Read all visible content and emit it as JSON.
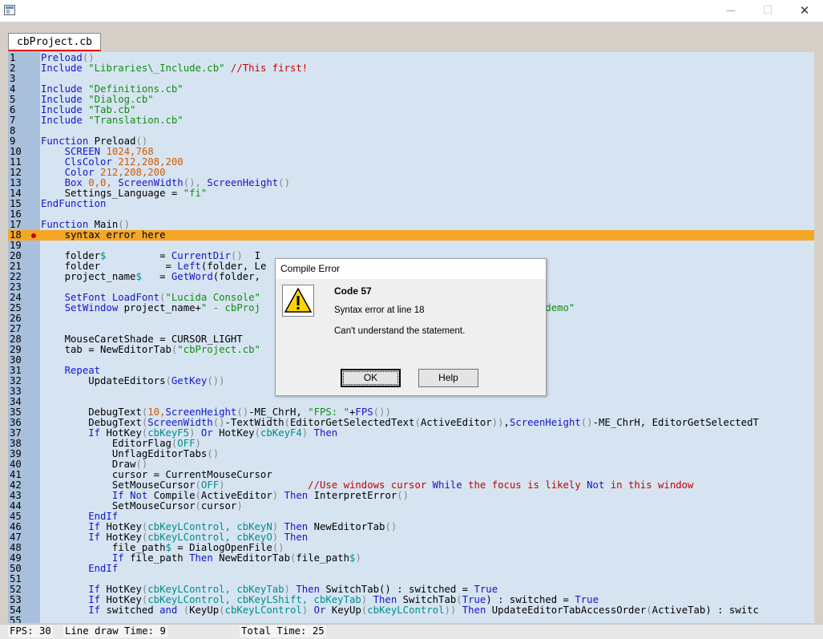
{
  "window": {
    "min_icon": "—",
    "max_icon": "☐",
    "close_icon": "✕"
  },
  "tab": {
    "label": "cbProject.cb"
  },
  "editor": {
    "lines": [
      {
        "n": "1",
        "t": [
          [
            "Preload",
            "kw"
          ],
          [
            "()",
            "dim"
          ]
        ]
      },
      {
        "n": "2",
        "t": [
          [
            "Include ",
            "kw"
          ],
          [
            "\"Libraries\\_Include.cb\" ",
            "str"
          ],
          [
            "//This first!",
            "com"
          ]
        ]
      },
      {
        "n": "3",
        "t": []
      },
      {
        "n": "4",
        "t": [
          [
            "Include ",
            "kw"
          ],
          [
            "\"Definitions.cb\"",
            "str"
          ]
        ]
      },
      {
        "n": "5",
        "t": [
          [
            "Include ",
            "kw"
          ],
          [
            "\"Dialog.cb\"",
            "str"
          ]
        ]
      },
      {
        "n": "6",
        "t": [
          [
            "Include ",
            "kw"
          ],
          [
            "\"Tab.cb\"",
            "str"
          ]
        ]
      },
      {
        "n": "7",
        "t": [
          [
            "Include ",
            "kw"
          ],
          [
            "\"Translation.cb\"",
            "str"
          ]
        ]
      },
      {
        "n": "8",
        "t": []
      },
      {
        "n": "9",
        "t": [
          [
            "Function ",
            "kw"
          ],
          [
            "Preload",
            "op"
          ],
          [
            "()",
            "dim"
          ]
        ]
      },
      {
        "n": "10",
        "t": [
          [
            "    SCREEN ",
            "kw"
          ],
          [
            "1024,768",
            "num"
          ]
        ]
      },
      {
        "n": "11",
        "t": [
          [
            "    ClsColor ",
            "kw"
          ],
          [
            "212,208,200",
            "num"
          ]
        ]
      },
      {
        "n": "12",
        "t": [
          [
            "    Color ",
            "kw"
          ],
          [
            "212,208,200",
            "num"
          ]
        ]
      },
      {
        "n": "13",
        "t": [
          [
            "    Box ",
            "kw"
          ],
          [
            "0,0, ",
            "num"
          ],
          [
            "ScreenWidth",
            "kw"
          ],
          [
            "(), ",
            "dim"
          ],
          [
            "ScreenHeight",
            "kw"
          ],
          [
            "()",
            "dim"
          ]
        ]
      },
      {
        "n": "14",
        "t": [
          [
            "    Settings_Language = ",
            "op"
          ],
          [
            "\"fi\"",
            "str"
          ]
        ]
      },
      {
        "n": "15",
        "t": [
          [
            "EndFunction",
            "kw"
          ]
        ]
      },
      {
        "n": "16",
        "t": []
      },
      {
        "n": "17",
        "t": [
          [
            "Function ",
            "kw"
          ],
          [
            "Main",
            "op"
          ],
          [
            "()",
            "dim"
          ]
        ]
      },
      {
        "n": "18",
        "t": [
          [
            "    syntax error here",
            "op"
          ]
        ],
        "err": true
      },
      {
        "n": "19",
        "t": []
      },
      {
        "n": "20",
        "t": [
          [
            "    folder",
            "op"
          ],
          [
            "$",
            "var"
          ],
          [
            "         = ",
            "op"
          ],
          [
            "CurrentDir",
            "kw"
          ],
          [
            "()  ",
            "dim"
          ],
          [
            "I",
            "op"
          ]
        ]
      },
      {
        "n": "21",
        "t": [
          [
            "    folder           = ",
            "op"
          ],
          [
            "Left",
            "kw"
          ],
          [
            "(folder, Le",
            "op"
          ]
        ]
      },
      {
        "n": "22",
        "t": [
          [
            "    project_name",
            "op"
          ],
          [
            "$",
            "var"
          ],
          [
            "   = ",
            "op"
          ],
          [
            "GetWord",
            "kw"
          ],
          [
            "(folder,",
            "op"
          ]
        ]
      },
      {
        "n": "23",
        "t": []
      },
      {
        "n": "24",
        "t": [
          [
            "    SetFont ",
            "kw"
          ],
          [
            "LoadFont",
            "kw"
          ],
          [
            "(",
            "dim"
          ],
          [
            "\"Lucida Console\"",
            "str"
          ]
        ]
      },
      {
        "n": "25",
        "t": [
          [
            "    SetWindow ",
            "kw"
          ],
          [
            "project_name+",
            "op"
          ],
          [
            "\" - cbProj",
            "str"
          ],
          [
            "                                 of the alpha's demo\"",
            "str"
          ]
        ]
      },
      {
        "n": "26",
        "t": []
      },
      {
        "n": "27",
        "t": []
      },
      {
        "n": "28",
        "t": [
          [
            "    MouseCaretShade = CURSOR_LIGHT",
            "op"
          ]
        ]
      },
      {
        "n": "29",
        "t": [
          [
            "    tab = NewEditorTab",
            "op"
          ],
          [
            "(",
            "dim"
          ],
          [
            "\"cbProject.cb\"",
            "str"
          ]
        ]
      },
      {
        "n": "30",
        "t": []
      },
      {
        "n": "31",
        "t": [
          [
            "    Repeat",
            "kw"
          ]
        ]
      },
      {
        "n": "32",
        "t": [
          [
            "        UpdateEditors",
            "op"
          ],
          [
            "(",
            "dim"
          ],
          [
            "GetKey",
            "kw"
          ],
          [
            "())",
            "dim"
          ]
        ]
      },
      {
        "n": "33",
        "t": []
      },
      {
        "n": "34",
        "t": []
      },
      {
        "n": "35",
        "t": [
          [
            "        DebugText",
            "op"
          ],
          [
            "(",
            "dim"
          ],
          [
            "10,",
            "num"
          ],
          [
            "ScreenHeight",
            "kw"
          ],
          [
            "()",
            "dim"
          ],
          [
            "-ME_ChrH, ",
            "op"
          ],
          [
            "\"FPS: \"",
            "str"
          ],
          [
            "+",
            "op"
          ],
          [
            "FPS",
            "kw"
          ],
          [
            "())",
            "dim"
          ]
        ]
      },
      {
        "n": "36",
        "t": [
          [
            "        DebugText",
            "op"
          ],
          [
            "(",
            "dim"
          ],
          [
            "ScreenWidth",
            "kw"
          ],
          [
            "()",
            "dim"
          ],
          [
            "-TextWidth",
            "op"
          ],
          [
            "(",
            "dim"
          ],
          [
            "EditorGetSelectedText",
            "op"
          ],
          [
            "(",
            "dim"
          ],
          [
            "ActiveEditor",
            "op"
          ],
          [
            "))",
            "dim"
          ],
          [
            ",",
            "op"
          ],
          [
            "ScreenHeight",
            "kw"
          ],
          [
            "()",
            "dim"
          ],
          [
            "-ME_ChrH, EditorGetSelectedT",
            "op"
          ]
        ]
      },
      {
        "n": "37",
        "t": [
          [
            "        If ",
            "kw"
          ],
          [
            "HotKey",
            "op"
          ],
          [
            "(",
            "dim"
          ],
          [
            "cbKeyF5",
            "var"
          ],
          [
            ") ",
            "dim"
          ],
          [
            "Or ",
            "kw"
          ],
          [
            "HotKey",
            "op"
          ],
          [
            "(",
            "dim"
          ],
          [
            "cbKeyF4",
            "var"
          ],
          [
            ") ",
            "dim"
          ],
          [
            "Then",
            "kw"
          ]
        ]
      },
      {
        "n": "38",
        "t": [
          [
            "            EditorFlag",
            "op"
          ],
          [
            "(",
            "dim"
          ],
          [
            "OFF",
            "var"
          ],
          [
            ")",
            "dim"
          ]
        ]
      },
      {
        "n": "39",
        "t": [
          [
            "            UnflagEditorTabs",
            "op"
          ],
          [
            "()",
            "dim"
          ]
        ]
      },
      {
        "n": "40",
        "t": [
          [
            "            Draw",
            "op"
          ],
          [
            "()",
            "dim"
          ]
        ]
      },
      {
        "n": "41",
        "t": [
          [
            "            cursor = CurrentMouseCursor",
            "op"
          ]
        ]
      },
      {
        "n": "42",
        "t": [
          [
            "            SetMouseCursor",
            "op"
          ],
          [
            "(",
            "dim"
          ],
          [
            "OFF",
            "var"
          ],
          [
            ")",
            "dim"
          ],
          [
            "              //Use windows cursor ",
            "com"
          ],
          [
            "While ",
            "kw"
          ],
          [
            "the focus is likely ",
            "com"
          ],
          [
            "Not ",
            "kw"
          ],
          [
            "in this window",
            "com"
          ]
        ]
      },
      {
        "n": "43",
        "t": [
          [
            "            If ",
            "kw"
          ],
          [
            "Not ",
            "kw"
          ],
          [
            "Compile",
            "op"
          ],
          [
            "(",
            "dim"
          ],
          [
            "ActiveEditor",
            "op"
          ],
          [
            ") ",
            "dim"
          ],
          [
            "Then ",
            "kw"
          ],
          [
            "InterpretError",
            "op"
          ],
          [
            "()",
            "dim"
          ]
        ]
      },
      {
        "n": "44",
        "t": [
          [
            "            SetMouseCursor",
            "op"
          ],
          [
            "(",
            "dim"
          ],
          [
            "cursor",
            "op"
          ],
          [
            ")",
            "dim"
          ]
        ]
      },
      {
        "n": "45",
        "t": [
          [
            "        EndIf",
            "kw"
          ]
        ]
      },
      {
        "n": "46",
        "t": [
          [
            "        If ",
            "kw"
          ],
          [
            "HotKey",
            "op"
          ],
          [
            "(",
            "dim"
          ],
          [
            "cbKeyLControl, cbKeyN",
            "var"
          ],
          [
            ") ",
            "dim"
          ],
          [
            "Then ",
            "kw"
          ],
          [
            "NewEditorTab",
            "op"
          ],
          [
            "()",
            "dim"
          ]
        ]
      },
      {
        "n": "47",
        "t": [
          [
            "        If ",
            "kw"
          ],
          [
            "HotKey",
            "op"
          ],
          [
            "(",
            "dim"
          ],
          [
            "cbKeyLControl, cbKeyO",
            "var"
          ],
          [
            ") ",
            "dim"
          ],
          [
            "Then",
            "kw"
          ]
        ]
      },
      {
        "n": "48",
        "t": [
          [
            "            file_path",
            "op"
          ],
          [
            "$",
            "var"
          ],
          [
            " = DialogOpenFile",
            "op"
          ],
          [
            "()",
            "dim"
          ]
        ]
      },
      {
        "n": "49",
        "t": [
          [
            "            If ",
            "kw"
          ],
          [
            "file_path ",
            "op"
          ],
          [
            "Then ",
            "kw"
          ],
          [
            "NewEditorTab",
            "op"
          ],
          [
            "(",
            "dim"
          ],
          [
            "file_path",
            "op"
          ],
          [
            "$",
            "var"
          ],
          [
            ")",
            "dim"
          ]
        ]
      },
      {
        "n": "50",
        "t": [
          [
            "        EndIf",
            "kw"
          ]
        ]
      },
      {
        "n": "51",
        "t": []
      },
      {
        "n": "52",
        "t": [
          [
            "        If ",
            "kw"
          ],
          [
            "HotKey",
            "op"
          ],
          [
            "(",
            "dim"
          ],
          [
            "cbKeyLControl, cbKeyTab",
            "var"
          ],
          [
            ") ",
            "dim"
          ],
          [
            "Then ",
            "kw"
          ],
          [
            "SwitchTab",
            "op"
          ],
          [
            "() : switched = ",
            "op"
          ],
          [
            "True",
            "kw"
          ]
        ]
      },
      {
        "n": "53",
        "t": [
          [
            "        If ",
            "kw"
          ],
          [
            "HotKey",
            "op"
          ],
          [
            "(",
            "dim"
          ],
          [
            "cbKeyLControl, cbKeyLShift, cbKeyTab",
            "var"
          ],
          [
            ") ",
            "dim"
          ],
          [
            "Then ",
            "kw"
          ],
          [
            "SwitchTab",
            "op"
          ],
          [
            "(",
            "dim"
          ],
          [
            "True",
            "kw"
          ],
          [
            ") : switched = ",
            "op"
          ],
          [
            "True",
            "kw"
          ]
        ]
      },
      {
        "n": "54",
        "t": [
          [
            "        If ",
            "kw"
          ],
          [
            "switched ",
            "op"
          ],
          [
            "and ",
            "kw"
          ],
          [
            "(",
            "dim"
          ],
          [
            "KeyUp",
            "op"
          ],
          [
            "(",
            "dim"
          ],
          [
            "cbKeyLControl",
            "var"
          ],
          [
            ") ",
            "dim"
          ],
          [
            "Or ",
            "kw"
          ],
          [
            "KeyUp",
            "op"
          ],
          [
            "(",
            "dim"
          ],
          [
            "cbKeyLControl",
            "var"
          ],
          [
            ")) ",
            "dim"
          ],
          [
            "Then ",
            "kw"
          ],
          [
            "UpdateEditorTabAccessOrder",
            "op"
          ],
          [
            "(",
            "dim"
          ],
          [
            "ActiveTab",
            "op"
          ],
          [
            ") : switc",
            "op"
          ]
        ]
      },
      {
        "n": "55",
        "t": []
      }
    ]
  },
  "status": {
    "fps": "FPS: 30",
    "line_draw": "Line draw Time: 9",
    "total": "Total Time: 25"
  },
  "dialog": {
    "title": "Compile Error",
    "icon": "warning-icon",
    "heading": "Code 57",
    "line1": "Syntax error at line 18",
    "line2": "Can't understand the statement.",
    "ok_label": "OK",
    "help_label": "Help"
  },
  "colors": {
    "gutter": "#a8c0dc",
    "editor_bg": "#d6e4f2",
    "error_line": "#f5a623",
    "keyword": "#1414c8",
    "string": "#148c14",
    "number": "#d05a00",
    "comment": "#c80000"
  }
}
